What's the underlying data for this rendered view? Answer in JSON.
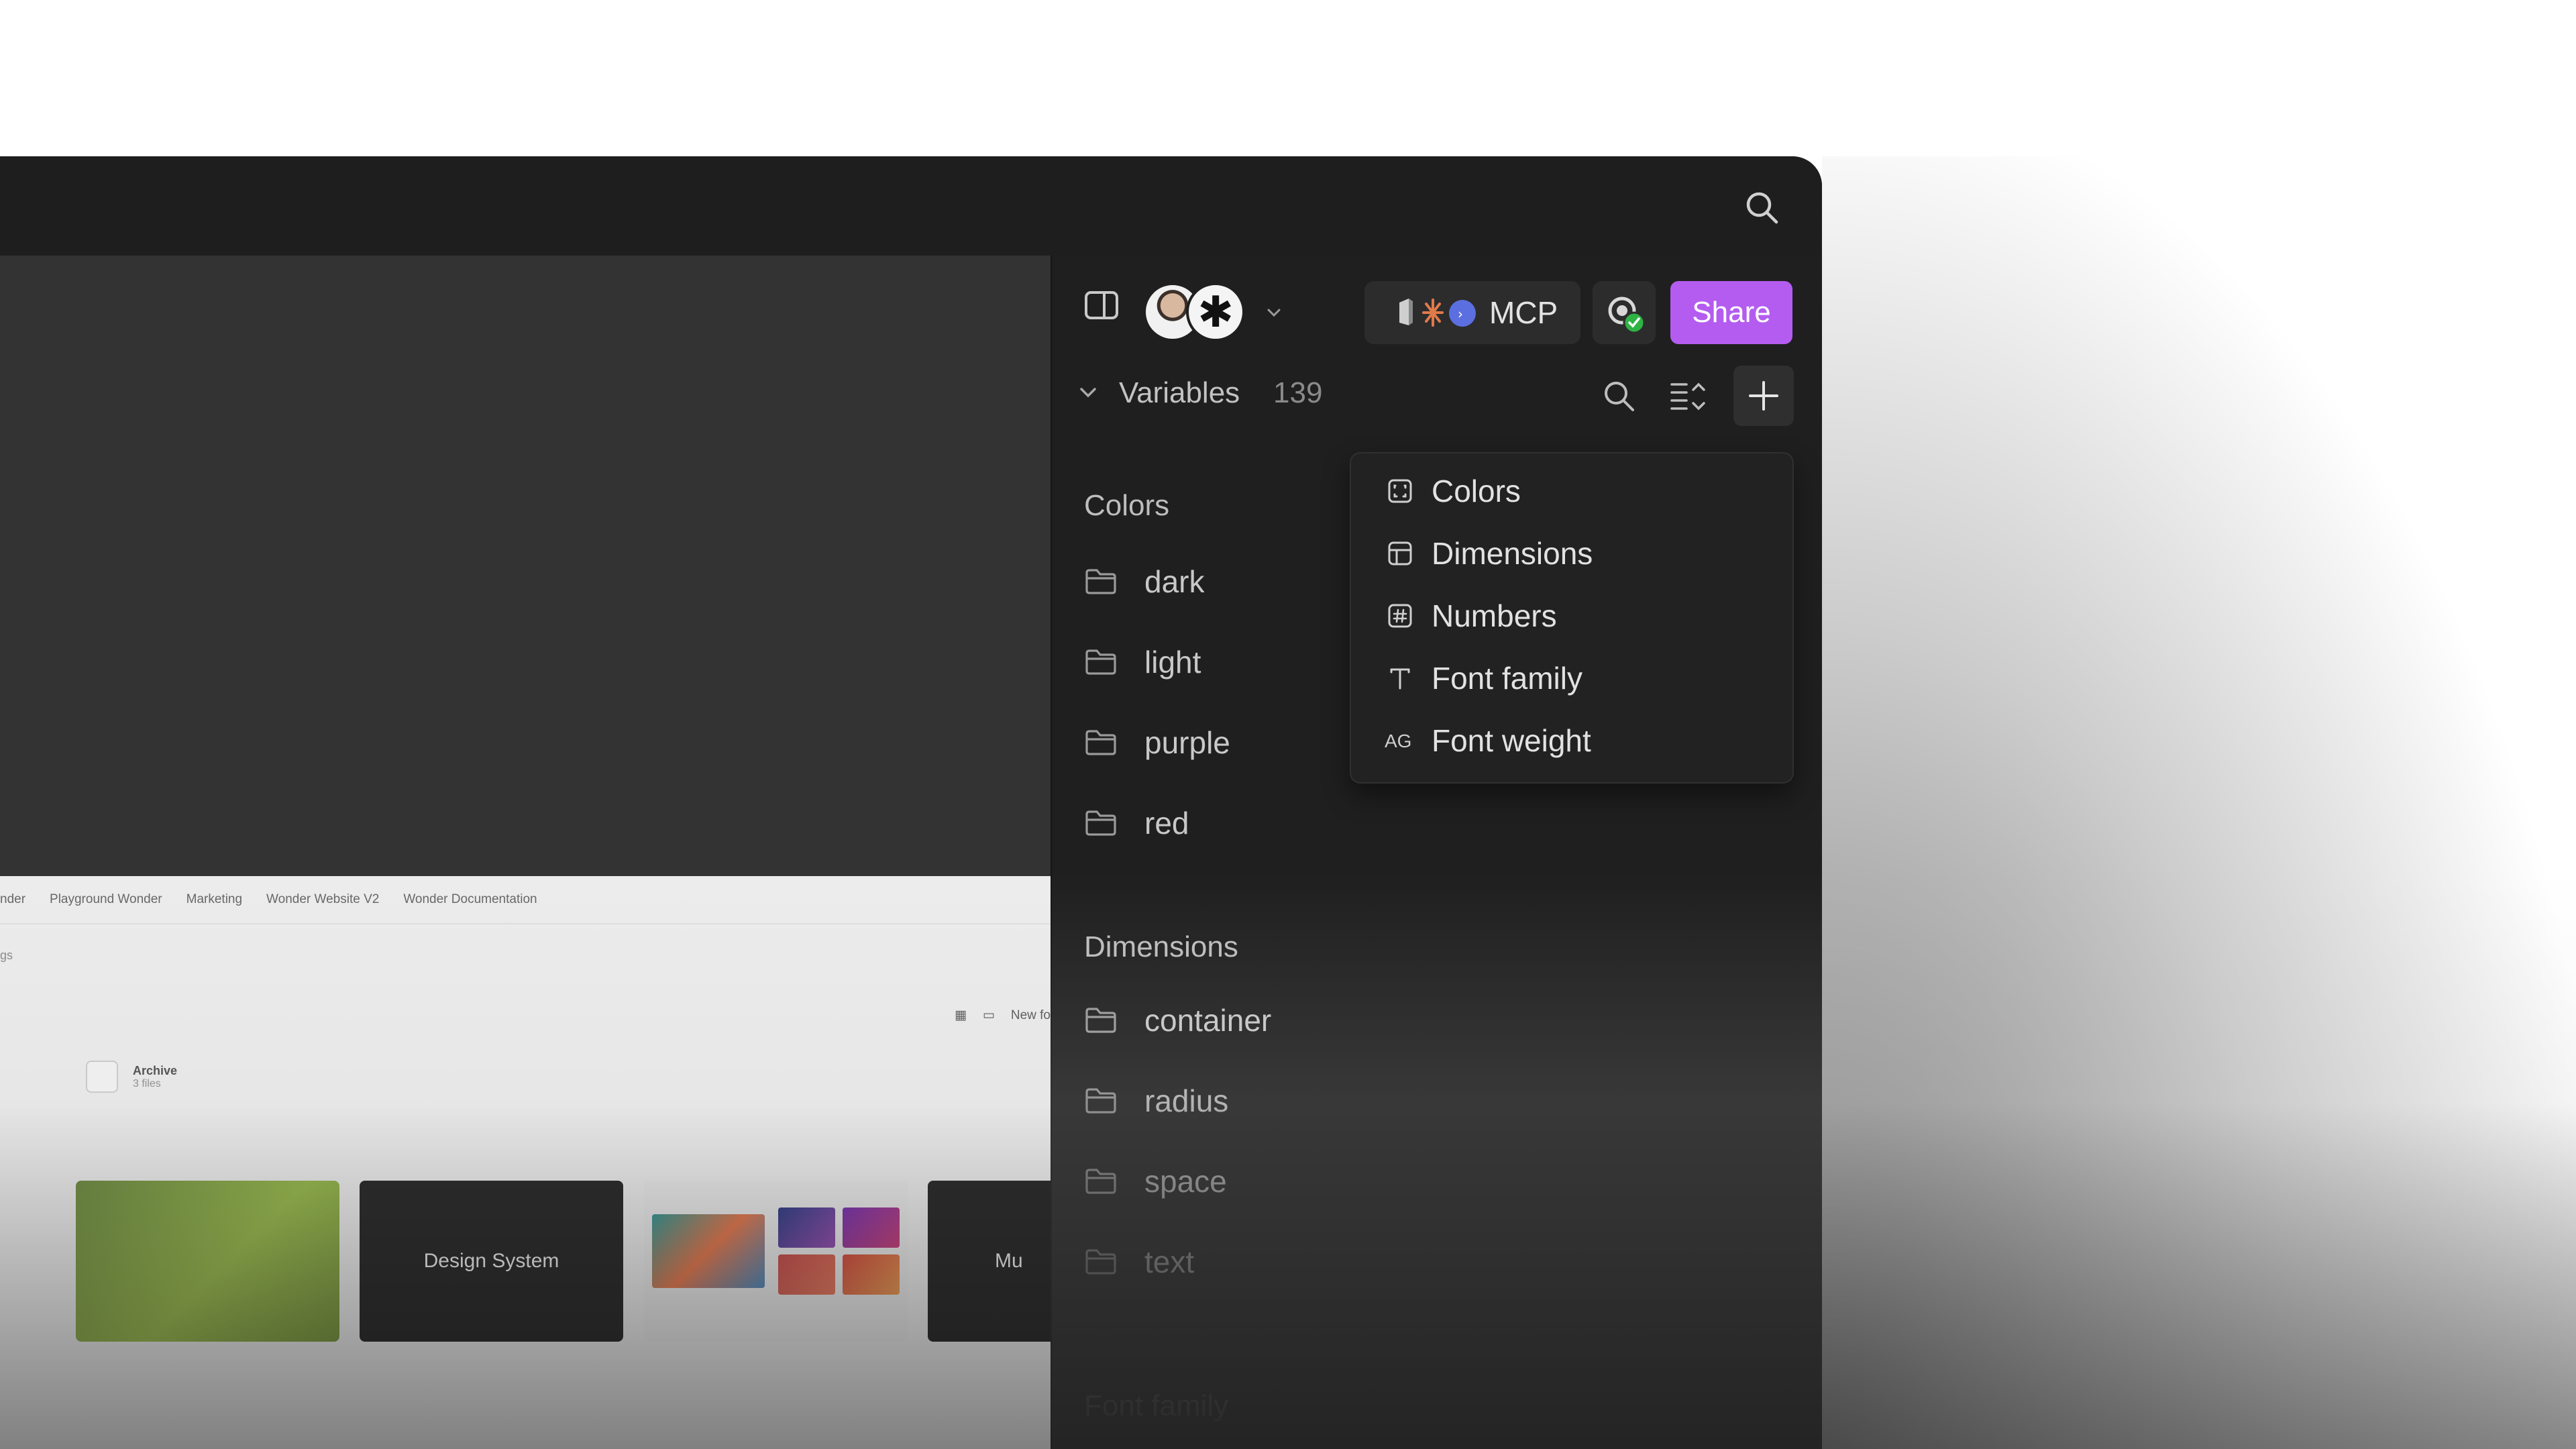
{
  "canvas": {
    "tabs": [
      "nder",
      "Playground Wonder",
      "Marketing",
      "Wonder Website V2",
      "Wonder Documentation"
    ],
    "subcrumb": "gs",
    "toolbar_new": "New fo",
    "archive": {
      "title": "Archive",
      "meta": "3 files"
    },
    "thumbs": [
      "Design System",
      "Mu"
    ]
  },
  "header": {
    "mcp_label": "MCP",
    "share_label": "Share"
  },
  "variables": {
    "title": "Variables",
    "count": "139"
  },
  "colors_section": {
    "title": "Colors",
    "folders": [
      "dark",
      "light",
      "purple",
      "red"
    ]
  },
  "dimensions_section": {
    "title": "Dimensions",
    "folders": [
      "container",
      "radius",
      "space",
      "text"
    ]
  },
  "font_family_section": {
    "title": "Font family"
  },
  "add_menu": {
    "items": [
      {
        "label": "Colors",
        "icon": "color-swatch-icon"
      },
      {
        "label": "Dimensions",
        "icon": "dimension-layout-icon"
      },
      {
        "label": "Numbers",
        "icon": "hash-icon"
      },
      {
        "label": "Font family",
        "icon": "text-t-icon"
      },
      {
        "label": "Font weight",
        "icon": "ag-icon"
      }
    ]
  },
  "colors": {
    "panel_bg": "#1f1f20",
    "accent_purple": "#b45cf0",
    "status_green": "#2fb344"
  }
}
